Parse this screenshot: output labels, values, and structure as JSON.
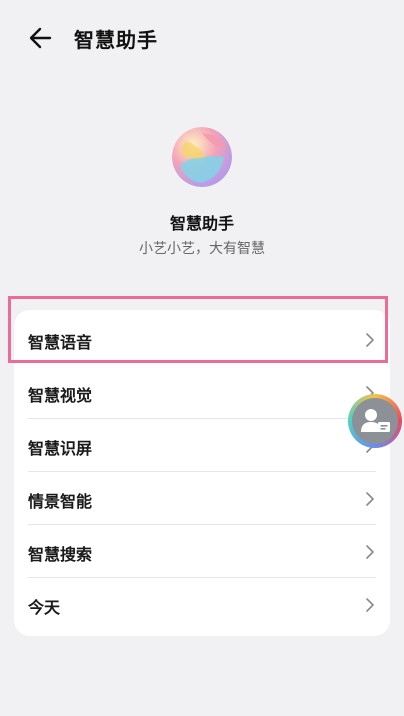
{
  "header": {
    "title": "智慧助手",
    "back_icon": "arrow-left-icon"
  },
  "profile": {
    "name": "智慧助手",
    "tagline": "小艺小艺，大有智慧",
    "logo_icon": "assistant-orb-logo"
  },
  "menu": {
    "items": [
      {
        "label": "智慧语音",
        "icon": "chevron-right-icon"
      },
      {
        "label": "智慧视觉",
        "icon": "chevron-right-icon"
      },
      {
        "label": "智慧识屏",
        "icon": "chevron-right-icon"
      },
      {
        "label": "情景智能",
        "icon": "chevron-right-icon"
      },
      {
        "label": "智慧搜索",
        "icon": "chevron-right-icon"
      },
      {
        "label": "今天",
        "icon": "chevron-right-icon"
      }
    ]
  },
  "highlight": {
    "target": "智慧语音",
    "color": "#ec6c98"
  },
  "floating_button": {
    "icon": "person-card-icon"
  },
  "colors": {
    "background": "#f1f1f3",
    "card": "#ffffff",
    "chevron": "#8a8a8a"
  }
}
